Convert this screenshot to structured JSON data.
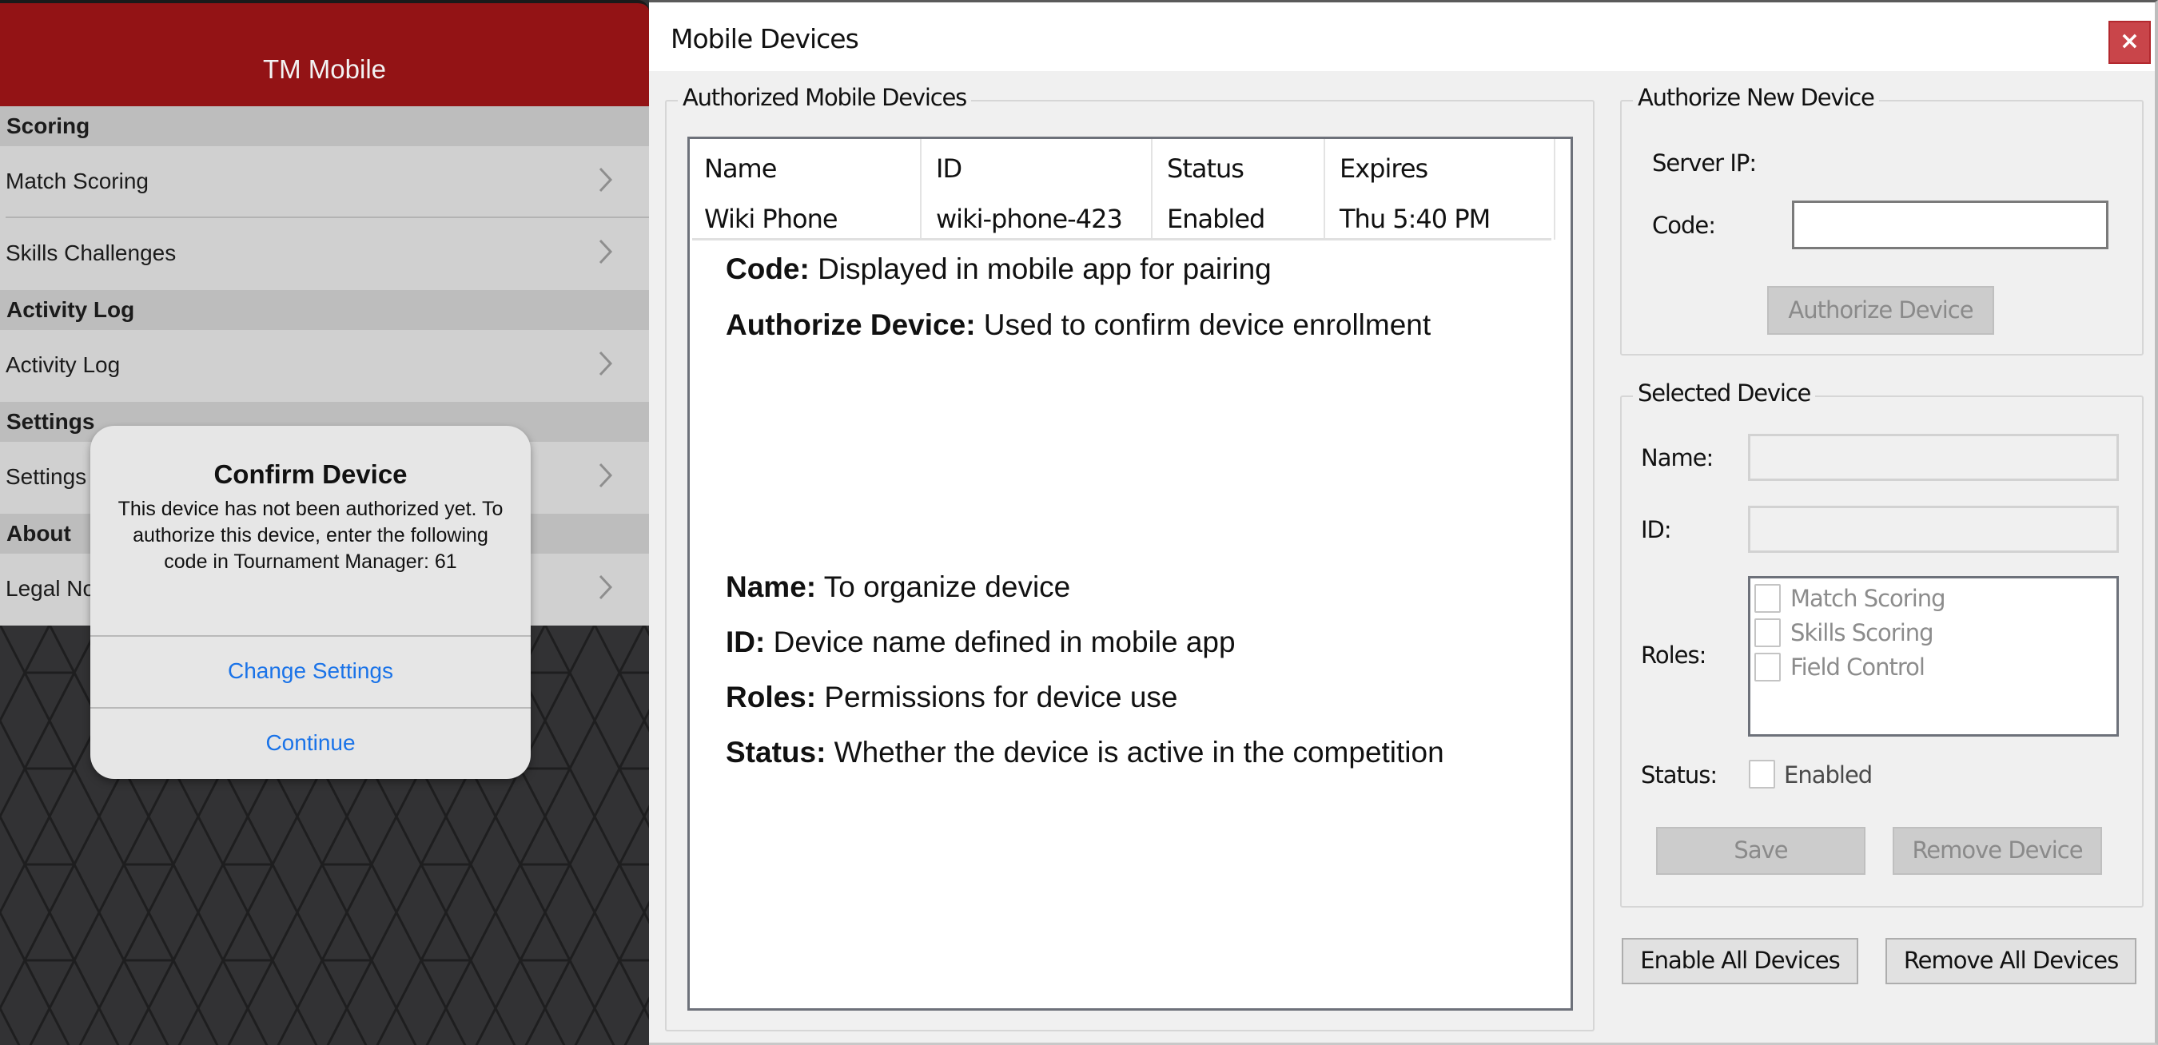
{
  "mobile": {
    "app_title": "TM Mobile",
    "sections": [
      {
        "header": "Scoring",
        "rows": [
          "Match Scoring",
          "Skills Challenges"
        ]
      },
      {
        "header": "Activity Log",
        "rows": [
          "Activity Log"
        ]
      },
      {
        "header": "Settings",
        "rows": [
          "Settings"
        ]
      },
      {
        "header": "About",
        "rows": [
          "Legal Notices"
        ]
      }
    ],
    "chevron_icon": "chevron-right-icon",
    "alert": {
      "title": "Confirm Device",
      "message": "This device has not been authorized yet. To authorize this device, enter the following code in Tournament Manager: 61",
      "buttons": [
        "Change Settings",
        "Continue"
      ],
      "button_color": "#1a73e8"
    },
    "header_color": "#931315"
  },
  "dialog": {
    "title": "Mobile Devices",
    "close_icon": "close-icon",
    "authorized_group": {
      "legend": "Authorized Mobile Devices",
      "columns": [
        "Name",
        "ID",
        "Status",
        "Expires"
      ],
      "rows": [
        {
          "name": "Wiki Phone",
          "id": "wiki-phone-423",
          "status": "Enabled",
          "expires": "Thu 5:40 PM"
        }
      ]
    },
    "annotations": [
      {
        "term": "Code:",
        "text": " Displayed in mobile app for pairing"
      },
      {
        "term": "Authorize Device:",
        "text": " Used to confirm device enrollment"
      },
      {
        "term": "Name:",
        "text": " To organize device"
      },
      {
        "term": "ID:",
        "text": " Device name defined in mobile app"
      },
      {
        "term": "Roles:",
        "text": " Permissions for device use"
      },
      {
        "term": "Status:",
        "text": " Whether the device is active in the competition"
      }
    ],
    "authorize_group": {
      "legend": "Authorize New Device",
      "server_ip_label": "Server IP:",
      "server_ip_value": "",
      "code_label": "Code:",
      "code_value": "",
      "authorize_button": "Authorize Device"
    },
    "selected_group": {
      "legend": "Selected Device",
      "name_label": "Name:",
      "name_value": "",
      "id_label": "ID:",
      "id_value": "",
      "roles_label": "Roles:",
      "roles": [
        {
          "label": "Match Scoring",
          "checked": false
        },
        {
          "label": "Skills Scoring",
          "checked": false
        },
        {
          "label": "Field Control",
          "checked": false
        }
      ],
      "status_label": "Status:",
      "status_checkbox_label": "Enabled",
      "status_checked": false,
      "save_button": "Save",
      "remove_button": "Remove Device"
    },
    "enable_all_button": "Enable All Devices",
    "remove_all_button": "Remove All Devices",
    "close_color": "#c9454a"
  }
}
